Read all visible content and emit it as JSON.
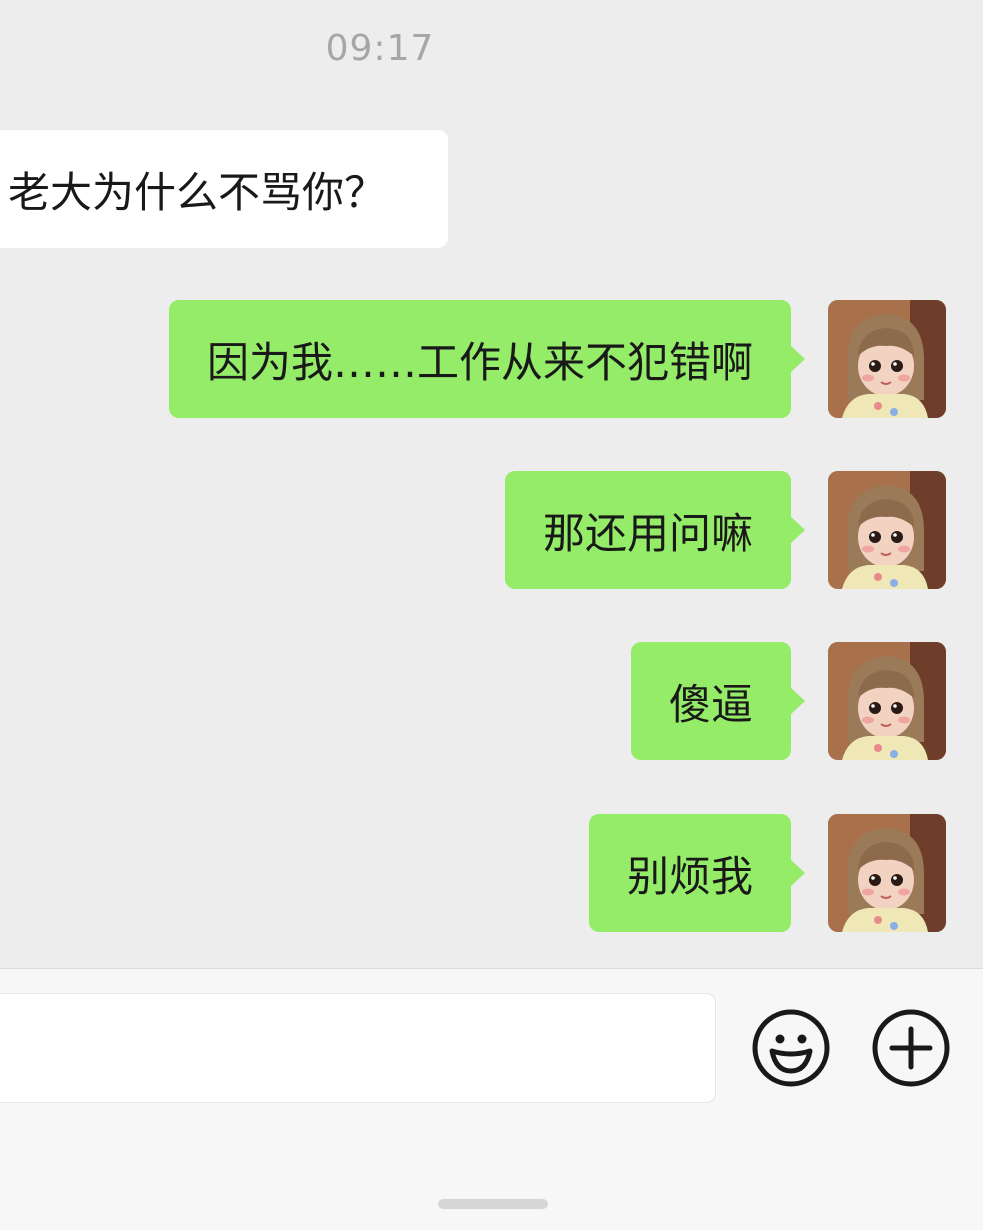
{
  "chat": {
    "timestamp": "09:17",
    "incoming": [
      {
        "text": "老大为什么不骂你？"
      }
    ],
    "outgoing": [
      {
        "text": "因为我……工作从来不犯错啊"
      },
      {
        "text": "那还用问嘛"
      },
      {
        "text": "傻逼"
      },
      {
        "text": "别烦我"
      }
    ]
  },
  "input": {
    "value": "",
    "placeholder": ""
  },
  "icons": {
    "emoji": "smiley-face-icon",
    "more": "plus-circle-icon"
  },
  "colors": {
    "background": "#ededed",
    "outgoing_bubble": "#95ec69",
    "incoming_bubble": "#ffffff",
    "timestamp": "#a6a6a6"
  }
}
